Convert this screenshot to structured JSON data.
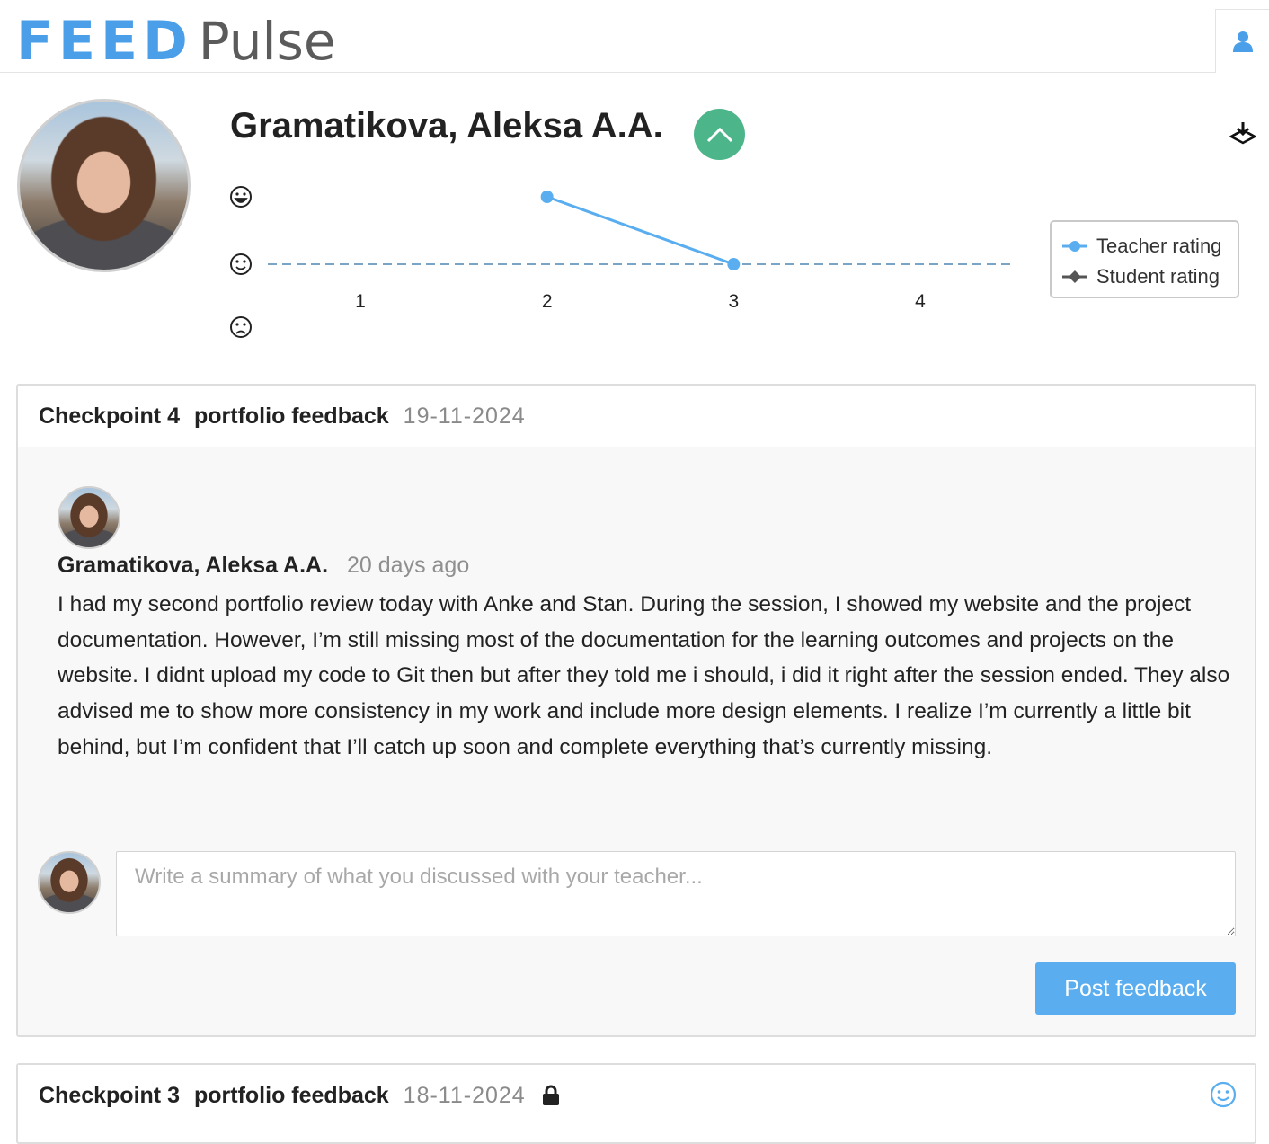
{
  "app": {
    "logo_feed": "FEED",
    "logo_pulse": "Pulse"
  },
  "header": {
    "user_icon": "user-icon"
  },
  "student": {
    "name": "Gramatikova, Aleksa A.A."
  },
  "actions": {
    "collapse_icon": "chevron-up-icon",
    "download_icon": "download-icon"
  },
  "chart_data": {
    "type": "line",
    "x": [
      1,
      2,
      3,
      4
    ],
    "xticks": [
      "1",
      "2",
      "3",
      "4"
    ],
    "y_levels": [
      "happy",
      "neutral",
      "sad"
    ],
    "y_level_icons": [
      "grin-icon",
      "smile-icon",
      "frown-icon"
    ],
    "series": [
      {
        "name": "Teacher rating",
        "color": "#5aaef0",
        "points": [
          {
            "x": 2,
            "y": "happy"
          },
          {
            "x": 3,
            "y": "neutral"
          }
        ]
      },
      {
        "name": "Student rating",
        "color": "#555555",
        "points": []
      }
    ],
    "baseline": "neutral",
    "legend_position": "right"
  },
  "legend": {
    "teacher": "Teacher rating",
    "student": "Student rating"
  },
  "checkpoints": [
    {
      "title": "Checkpoint 4",
      "type": "portfolio feedback",
      "date": "19-11-2024",
      "feedback": {
        "author": "Gramatikova, Aleksa A.A.",
        "time": "20 days ago",
        "text": "I had my second portfolio review today with Anke and Stan. During the session, I showed my website and the project documentation. However, I’m still missing most of the documentation for the learning outcomes and projects on the website. I didnt upload my code to Git then but after they told me i should, i did it right after the session ended. They also advised me to show more consistency in my work and include more design elements. I realize I’m currently a little bit behind, but I’m confident that I’ll catch up soon and complete everything that’s currently missing."
      },
      "summary_placeholder": "Write a summary of what you discussed with your teacher...",
      "post_label": "Post feedback"
    },
    {
      "title": "Checkpoint 3",
      "type": "portfolio feedback",
      "date": "18-11-2024",
      "lock_icon": "lock-icon",
      "rating_icon": "smile-icon"
    }
  ],
  "colors": {
    "accent": "#5aaef0",
    "collapse": "#4db58a",
    "logo_blue": "#4a9fe8"
  }
}
